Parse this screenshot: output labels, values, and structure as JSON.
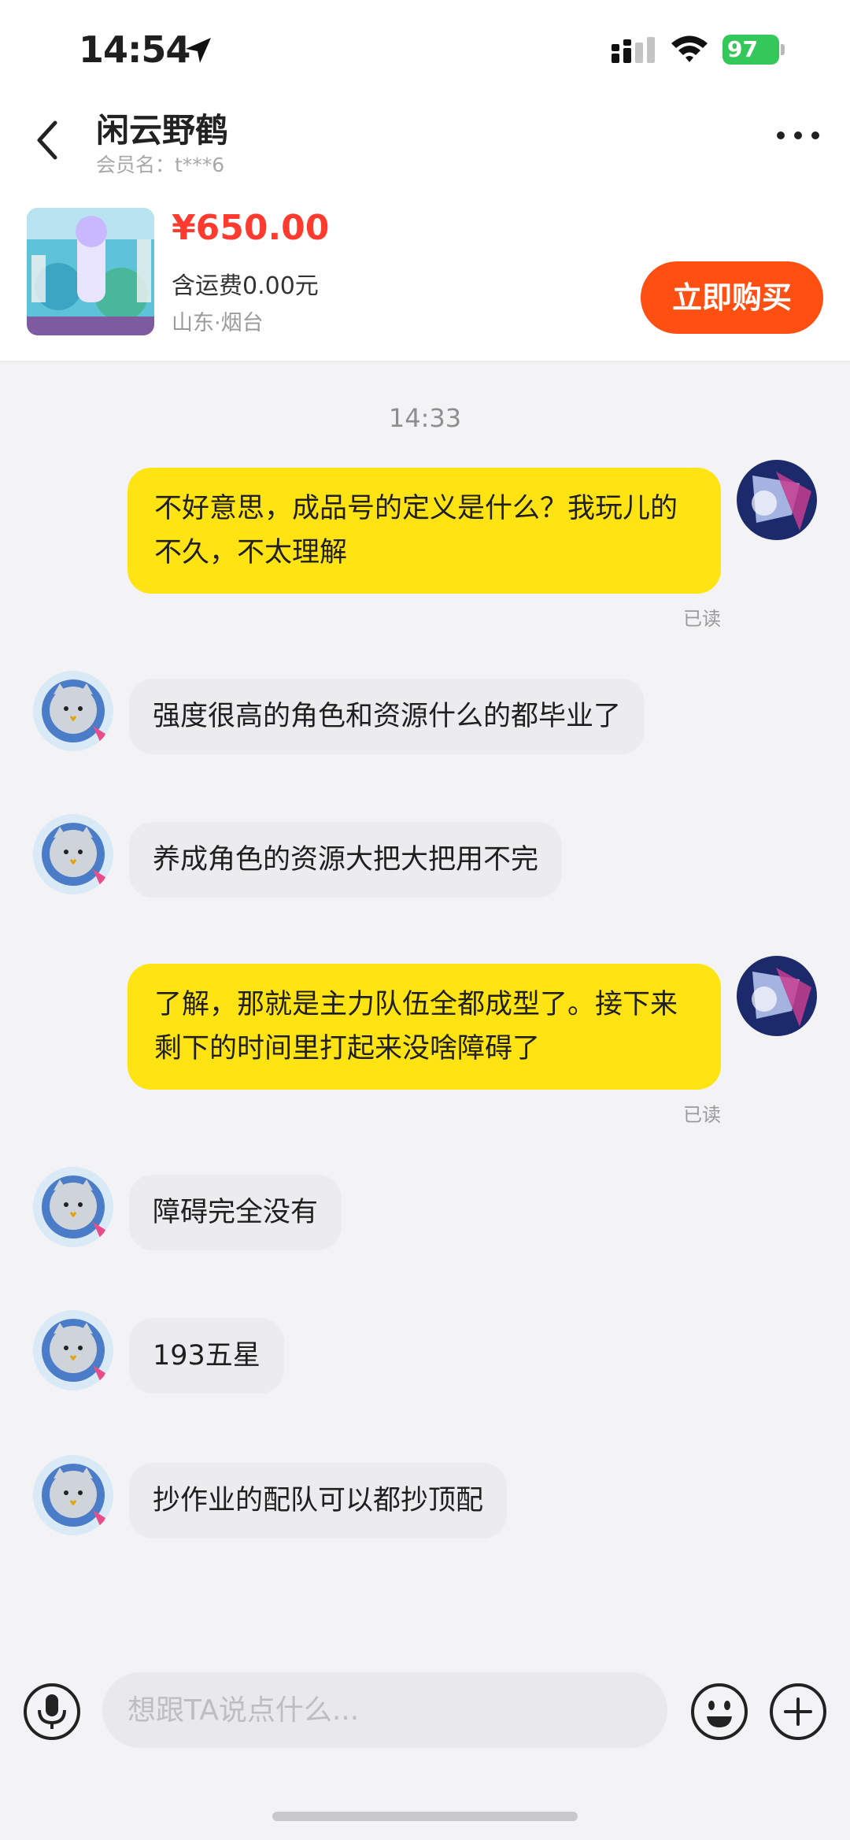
{
  "status_bar": {
    "time": "14:54",
    "battery": "97"
  },
  "header": {
    "title": "闲云野鹤",
    "member_name": "会员名：t***6",
    "icons": [
      "back-icon",
      "more-icon"
    ]
  },
  "product": {
    "price": "¥650.00",
    "shipping": "含运费0.00元",
    "location": "山东·烟台",
    "buy_label": "立即购买"
  },
  "chat": {
    "timestamp": "14:33",
    "read_label": "已读",
    "messages": [
      {
        "side": "out",
        "text": "不好意思，成品号的定义是什么？我玩儿的不久，不太理解",
        "read": "已读"
      },
      {
        "side": "in",
        "text": "强度很高的角色和资源什么的都毕业了"
      },
      {
        "side": "in",
        "text": "养成角色的资源大把大把用不完"
      },
      {
        "side": "out",
        "text": "了解，那就是主力队伍全都成型了。接下来剩下的时间里打起来没啥障碍了",
        "read": "已读"
      },
      {
        "side": "in",
        "text": "障碍完全没有"
      },
      {
        "side": "in",
        "text": "193五星"
      },
      {
        "side": "in",
        "text": "抄作业的配队可以都抄顶配"
      }
    ]
  },
  "input": {
    "placeholder": "想跟TA说点什么..."
  },
  "colors": {
    "accent": "#ff4f12",
    "price": "#ff3b30",
    "outgoing_bubble": "#ffe312",
    "incoming_bubble": "#ececee"
  }
}
